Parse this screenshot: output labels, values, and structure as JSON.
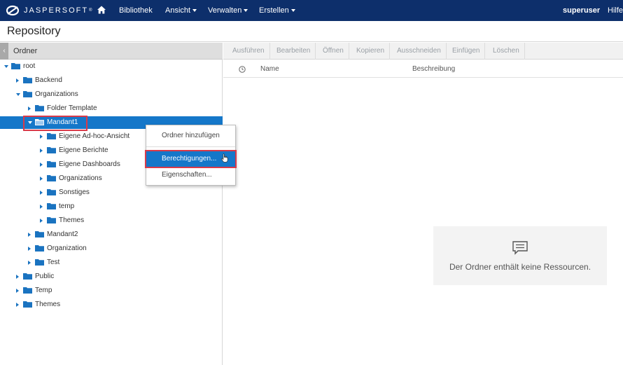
{
  "nav": {
    "brand": "JASPERSOFT",
    "trademark": "®",
    "items": [
      {
        "label": "Bibliothek",
        "dropdown": false
      },
      {
        "label": "Ansicht",
        "dropdown": true
      },
      {
        "label": "Verwalten",
        "dropdown": true
      },
      {
        "label": "Erstellen",
        "dropdown": true
      }
    ],
    "user": "superuser",
    "help": "Hilfe"
  },
  "page": {
    "title": "Repository"
  },
  "folders_pane": {
    "title": "Ordner",
    "collapse_glyph": "‹",
    "tree": [
      {
        "label": "root",
        "expanded": true
      },
      {
        "label": "Backend",
        "expanded": false
      },
      {
        "label": "Organizations",
        "expanded": true
      },
      {
        "label": "Folder Template",
        "expanded": false
      },
      {
        "label": "Mandant1",
        "expanded": true,
        "selected": true
      },
      {
        "label": "Eigene Ad-hoc-Ansicht",
        "expanded": false
      },
      {
        "label": "Eigene Berichte",
        "expanded": false
      },
      {
        "label": "Eigene Dashboards",
        "expanded": false
      },
      {
        "label": "Organizations",
        "expanded": false
      },
      {
        "label": "Sonstiges",
        "expanded": false
      },
      {
        "label": "temp",
        "expanded": false
      },
      {
        "label": "Themes",
        "expanded": false
      },
      {
        "label": "Mandant2",
        "expanded": false
      },
      {
        "label": "Organization",
        "expanded": false
      },
      {
        "label": "Test",
        "expanded": false
      },
      {
        "label": "Public",
        "expanded": false
      },
      {
        "label": "Temp",
        "expanded": false
      },
      {
        "label": "Themes",
        "expanded": false
      }
    ]
  },
  "context_menu": {
    "items": [
      {
        "label": "Ordner hinzufügen",
        "highlighted": false
      },
      {
        "label": "Berechtigungen...",
        "highlighted": true
      },
      {
        "label": "Eigenschaften...",
        "highlighted": false
      }
    ]
  },
  "toolbar": {
    "buttons": [
      "Ausführen",
      "Bearbeiten",
      "Öffnen",
      "Kopieren",
      "Ausschneiden",
      "Einfügen",
      "Löschen"
    ]
  },
  "columns": {
    "name": "Name",
    "description": "Beschreibung"
  },
  "empty_state": {
    "message": "Der Ordner enthält keine Ressourcen."
  },
  "colors": {
    "nav_bg": "#0d2f6b",
    "selection": "#1577c9",
    "highlight_outline": "#d93a49",
    "folder": "#1a73c0"
  }
}
